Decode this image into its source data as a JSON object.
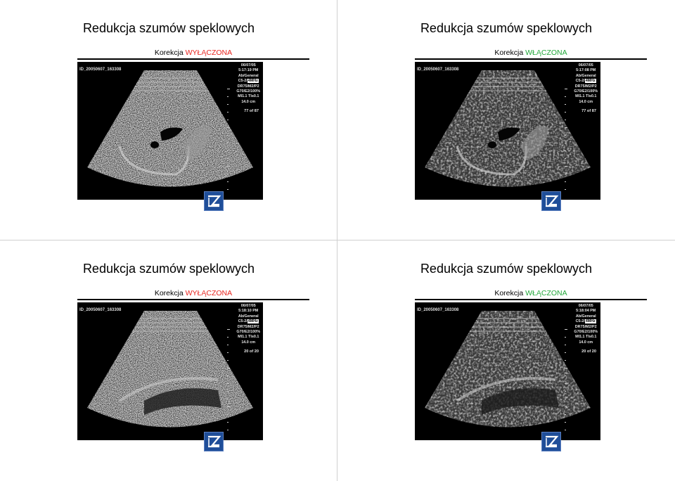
{
  "slides": [
    {
      "title": "Redukcja szumów speklowych",
      "sub_prefix": "Korekcja",
      "sub_state": "WYŁĄCZONA",
      "state_color": "#e8231d",
      "id": "ID_20050607_163308",
      "date": "06/07/05",
      "time": "5:17:19 PM",
      "preset": "Ab/General",
      "probe": "C5-2/",
      "freq": "4MHz",
      "dr": "DR75/M2/P2",
      "gain": "G70/E2/100%",
      "mi": "MI1.1  TIs0.1",
      "depth": "14.0 cm",
      "frame": "77 of 87"
    },
    {
      "title": "Redukcja szumów speklowych",
      "sub_prefix": "Korekcja",
      "sub_state": "WŁĄCZONA",
      "state_color": "#22a83a",
      "id": "ID_20050607_163308",
      "date": "06/07/05",
      "time": "5:17:08 PM",
      "preset": "Ab/General",
      "probe": "C5-2/",
      "freq": "4MHz",
      "dr": "DR75/M2/P2",
      "gain": "G70/E2/100%",
      "mi": "MI1.1  TIs0.1",
      "depth": "14.0 cm",
      "frame": "77 of 87"
    },
    {
      "title": "Redukcja szumów speklowych",
      "sub_prefix": "Korekcja",
      "sub_state": "WYŁĄCZONA",
      "state_color": "#e8231d",
      "id": "ID_20050607_163308",
      "date": "06/07/05",
      "time": "5:18:10 PM",
      "preset": "Ab/General",
      "probe": "C5-2/",
      "freq": "4MHz",
      "dr": "DR75/M2/P2",
      "gain": "G70/E2/100%",
      "mi": "MI1.1  TIs0.1",
      "depth": "14.0 cm",
      "frame": "20 of 20"
    },
    {
      "title": "Redukcja szumów speklowych",
      "sub_prefix": "Korekcja",
      "sub_state": "WŁĄCZONA",
      "state_color": "#22a83a",
      "id": "ID_20050607_163308",
      "date": "06/07/05",
      "time": "5:18:04 PM",
      "preset": "Ab/General",
      "probe": "C5-2/",
      "freq": "4MHz",
      "dr": "DR75/M2/P2",
      "gain": "G70/E2/100%",
      "mi": "MI1.1  TIs0.1",
      "depth": "14.0 cm",
      "frame": "20 of 20"
    }
  ],
  "colors": {
    "logo_bg": "#1f4e99",
    "logo_border": "#5b7fc0"
  },
  "icons": {
    "logo": "z-logo-icon"
  }
}
